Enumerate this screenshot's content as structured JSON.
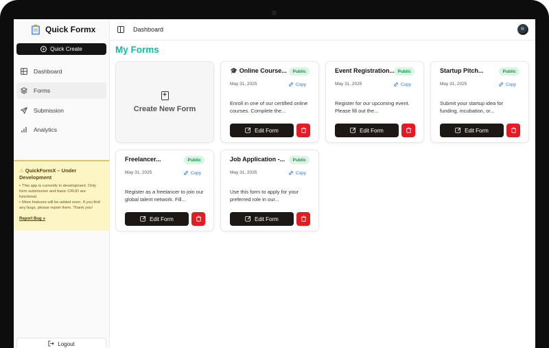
{
  "app": {
    "name": "Quick Formx"
  },
  "sidebar": {
    "quick_create_label": "Quick Create",
    "items": [
      {
        "label": "Dashboard",
        "icon": "dashboard-icon",
        "active": false
      },
      {
        "label": "Forms",
        "icon": "layers-icon",
        "active": true
      },
      {
        "label": "Submission",
        "icon": "send-icon",
        "active": false
      },
      {
        "label": "Analytics",
        "icon": "bar-chart-icon",
        "active": false
      }
    ],
    "notice": {
      "title": "QuickFormX – Under Development",
      "lines": [
        "This app is currently in development. Only form submission and basic CRUD are functional.",
        "More features will be added soon. If you find any bugs, please report them. Thank you!"
      ],
      "report_label": "Report Bug"
    },
    "logout_label": "Logout"
  },
  "topbar": {
    "breadcrumb": "Dashboard"
  },
  "main": {
    "title": "My Forms",
    "create_label": "Create New Form",
    "forms": [
      {
        "title": "🎓 Online Course...",
        "badge": "Public",
        "date": "May 31, 2025",
        "copy_label": "Copy",
        "description": "Enroll in one of our certified online courses. Complete the...",
        "edit_label": "Edit Form"
      },
      {
        "title": "Event Registration...",
        "badge": "Public",
        "date": "May 31, 2025",
        "copy_label": "Copy",
        "description": "Register for our upcoming event. Please fill out the...",
        "edit_label": "Edit Form"
      },
      {
        "title": "Startup Pitch...",
        "badge": "Public",
        "date": "May 31, 2025",
        "copy_label": "Copy",
        "description": "Submit your startup idea for funding, incubation, or...",
        "edit_label": "Edit Form"
      },
      {
        "title": "Freelancer...",
        "badge": "Public",
        "date": "May 31, 2025",
        "copy_label": "Copy",
        "description": "Register as a freelancer to join our global talent network. Fill...",
        "edit_label": "Edit Form"
      },
      {
        "title": "Job Application -...",
        "badge": "Public",
        "date": "May 31, 2025",
        "copy_label": "Copy",
        "description": "Use this form to apply for your preferred role in our...",
        "edit_label": "Edit Form"
      }
    ]
  },
  "colors": {
    "accent": "#18b8a4",
    "danger": "#e51b23",
    "badge_bg": "#d9f5e4",
    "notice_bg": "#fdf5c4"
  }
}
